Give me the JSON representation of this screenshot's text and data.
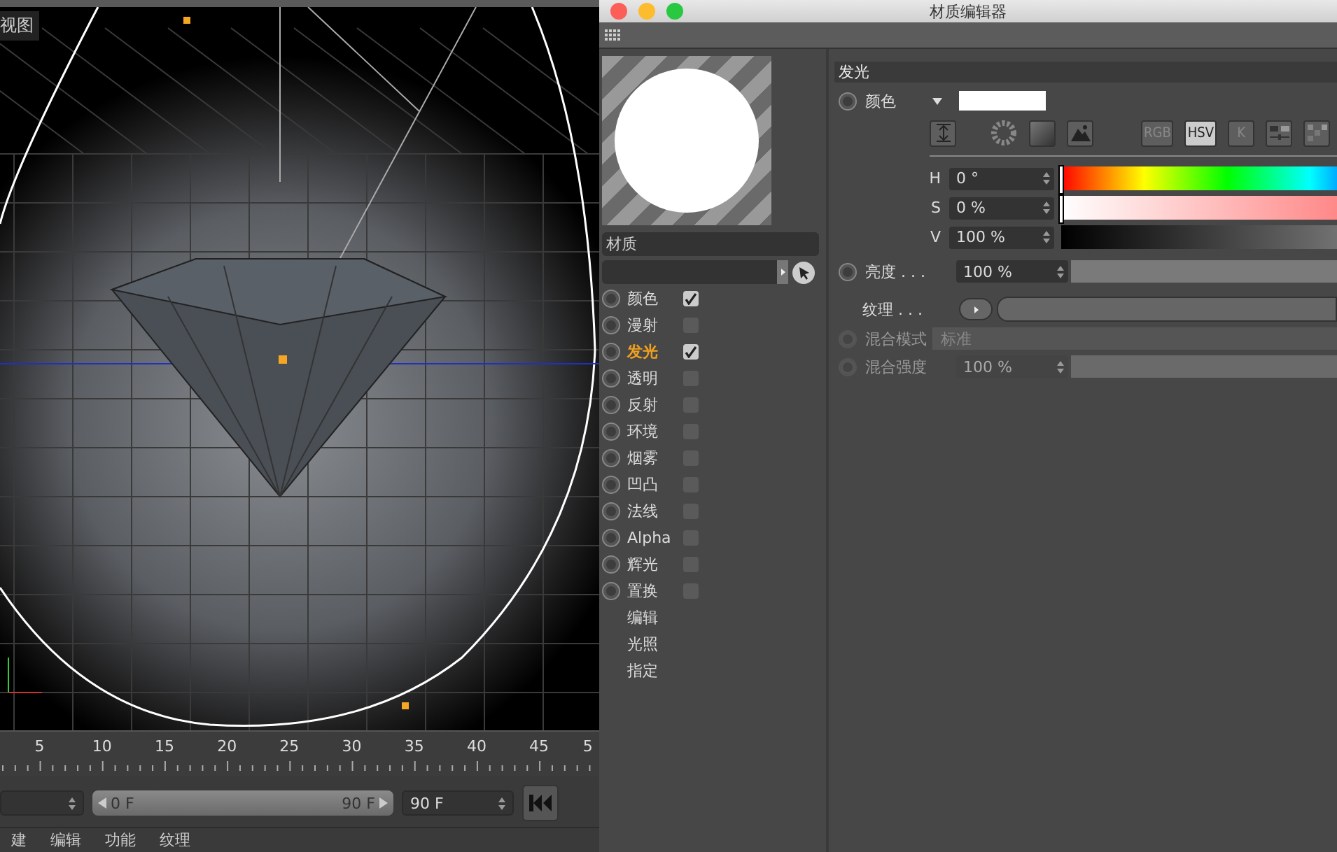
{
  "viewport": {
    "label": "视图"
  },
  "timeline": {
    "ticks": [
      "5",
      "10",
      "15",
      "20",
      "25",
      "30",
      "35",
      "40",
      "45",
      "5"
    ]
  },
  "playback": {
    "range_start": "0 F",
    "range_end": "90 F",
    "level": 1,
    "end_field": "90 F"
  },
  "menu": [
    "建",
    "编辑",
    "功能",
    "纹理"
  ],
  "editor": {
    "title": "材质编辑器",
    "material_name": "材质",
    "channels": [
      {
        "label": "颜色",
        "checked": true,
        "selected": false,
        "keyframed": false
      },
      {
        "label": "漫射",
        "checked": false,
        "selected": false,
        "keyframed": false
      },
      {
        "label": "发光",
        "checked": true,
        "selected": true,
        "keyframed": false
      },
      {
        "label": "透明",
        "checked": false,
        "selected": false,
        "keyframed": false
      },
      {
        "label": "反射",
        "checked": false,
        "selected": false,
        "keyframed": false
      },
      {
        "label": "环境",
        "checked": false,
        "selected": false,
        "keyframed": false
      },
      {
        "label": "烟雾",
        "checked": false,
        "selected": false,
        "keyframed": false
      },
      {
        "label": "凹凸",
        "checked": false,
        "selected": false,
        "keyframed": false
      },
      {
        "label": "法线",
        "checked": false,
        "selected": false,
        "keyframed": false
      },
      {
        "label": "Alpha",
        "checked": false,
        "selected": false,
        "keyframed": false
      },
      {
        "label": "辉光",
        "checked": false,
        "selected": false,
        "keyframed": false
      },
      {
        "label": "置换",
        "checked": false,
        "selected": false,
        "keyframed": false
      }
    ],
    "extra_items": [
      "编辑",
      "光照",
      "指定"
    ],
    "section": "发光",
    "color": {
      "label": "颜色",
      "color": "#ffffff",
      "keyframed": false
    },
    "modes": [
      {
        "label": "RGB",
        "selected": false
      },
      {
        "label": "HSV",
        "selected": true
      },
      {
        "label": "K",
        "selected": false
      }
    ],
    "hsv": [
      {
        "kind": "hue",
        "label": "H",
        "value": "0 °",
        "level": 0
      },
      {
        "kind": "saturation",
        "label": "S",
        "value": "0 %",
        "level": 0
      },
      {
        "kind": "value",
        "label": "V",
        "value": "100 %"
      }
    ],
    "brightness": {
      "label": "亮度 . . .",
      "value": "100 %",
      "level": 1,
      "keyframed": false
    },
    "texture": {
      "label": "纹理 . . ."
    },
    "blend_mode": {
      "label": "混合模式",
      "value": "标准",
      "disabled": true,
      "keyframed": false
    },
    "blend_strength": {
      "label": "混合强度",
      "value": "100 %",
      "level": 1,
      "disabled": true,
      "keyframed": false
    }
  }
}
